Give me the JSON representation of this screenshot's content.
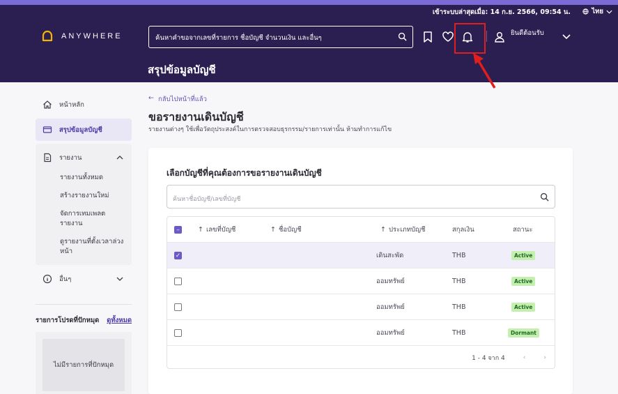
{
  "topbar": {
    "last_login": "เข้าระบบล่าสุดเมื่อ: 14 ก.ย. 2566, 09:54 น.",
    "language": "ไทย"
  },
  "header": {
    "logo_text": "ANYWHERE",
    "search_placeholder": "ค้นหาคำขอจากเลขที่รายการ ชื่อบัญชี จำนวนเงิน และอื่นๆ",
    "welcome": "ยินดีต้อนรับ",
    "page_title": "สรุปข้อมูลบัญชี"
  },
  "sidebar": {
    "home": "หน้าหลัก",
    "summary": "สรุปข้อมูลบัญชี",
    "reports": "รายงาน",
    "report_items": [
      "รายงานทั้งหมด",
      "สร้างรายงานใหม่",
      "จัดการเทมเพลตรายงาน",
      "ดูรายงานที่ตั้งเวลาล่วงหน้า"
    ],
    "others": "อื่นๆ",
    "pinned_title": "รายการโปรดที่ปักหมุด",
    "see_all": "ดูทั้งหมด",
    "no_pinned": "ไม่มีรายการที่ปักหมุด"
  },
  "main": {
    "back": "กลับไปหน้าที่แล้ว",
    "title": "ขอรายงานเดินบัญชี",
    "description": "รายงานต่างๆ ใช้เพื่อวัตถุประสงค์ในการตรวจสอบธุรกรรม/รายการเท่านั้น ห้ามทำการแก้ไข",
    "card_title": "เลือกบัญชีที่คุณต้องการขอรายงานเดินบัญชี",
    "card_search_placeholder": "ค้นหาชื่อบัญชี/เลขที่บัญชี",
    "columns": {
      "account_no": "เลขที่บัญชี",
      "account_name": "ชื่อบัญชี",
      "type": "ประเภทบัญชี",
      "currency": "สกุลเงิน",
      "status": "สถานะ"
    },
    "rows": [
      {
        "type": "เดินสะพัด",
        "currency": "THB",
        "status": "Active",
        "checked": true
      },
      {
        "type": "ออมทรัพย์",
        "currency": "THB",
        "status": "Active",
        "checked": false
      },
      {
        "type": "ออมทรัพย์",
        "currency": "THB",
        "status": "Active",
        "checked": false
      },
      {
        "type": "ออมทรัพย์",
        "currency": "THB",
        "status": "Dormant",
        "checked": false
      }
    ],
    "pagination": "1 - 4 จาก 4"
  },
  "colors": {
    "header_bg": "#2b1f52",
    "accent": "#6b5bc4",
    "annotation": "#e01e1e"
  }
}
